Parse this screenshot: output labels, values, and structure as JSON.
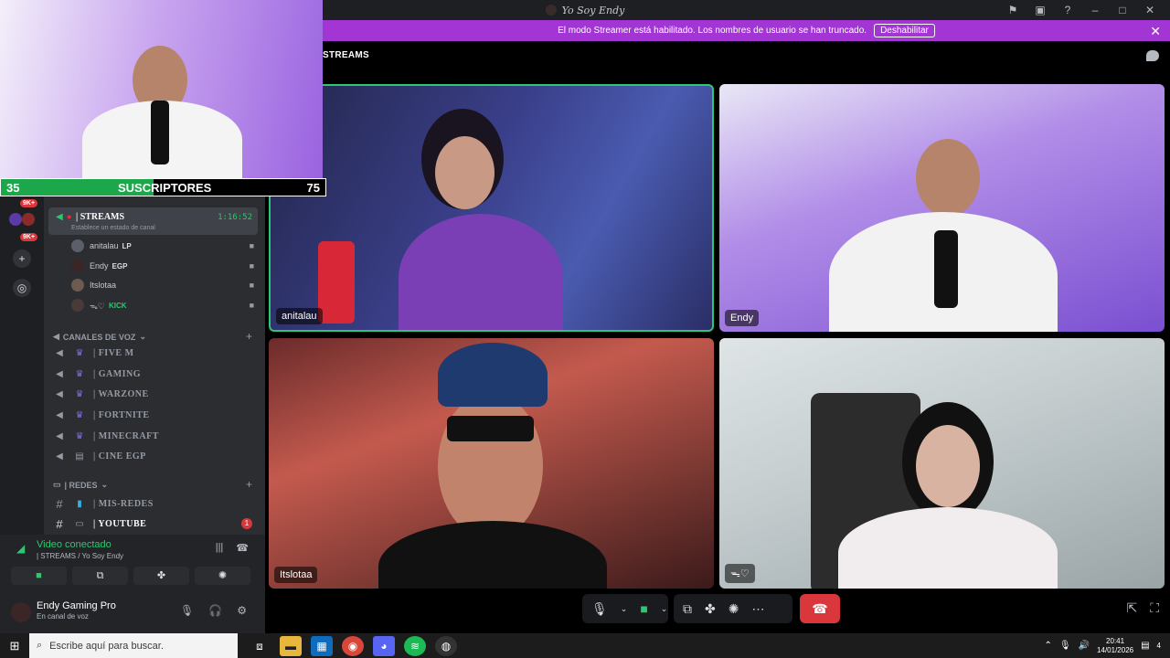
{
  "window": {
    "title": "Yo Soy Endy"
  },
  "banner": {
    "text": "El modo Streamer está habilitado. Los nombres de usuario se han truncado.",
    "button": "Deshabilitar"
  },
  "call": {
    "header": "STREAMS",
    "tiles": [
      {
        "name": "anitalau"
      },
      {
        "name": "Endy"
      },
      {
        "name": "Itslotaa"
      },
      {
        "name": "ᯓ♡"
      }
    ]
  },
  "overlay": {
    "left_count": "35",
    "label": "SUSCRIPTORES",
    "right_count": "75",
    "progress": 0.47
  },
  "rail": {
    "badges": [
      "9K+",
      "9K+"
    ]
  },
  "sidebar": {
    "active_channel": {
      "label": "| STREAMS",
      "status": "Establece un estado de canal",
      "timer": "1:16:52"
    },
    "members": [
      {
        "name": "anitalau",
        "tag": "LP"
      },
      {
        "name": "Endy",
        "tag": "EGP"
      },
      {
        "name": "Itslotaa",
        "tag": ""
      },
      {
        "name": "ᯓ♡",
        "tag": "KICK"
      }
    ],
    "voice_category": "CANALES DE VOZ",
    "voice_channels": [
      "| FIVE M",
      "| GAMING",
      "| WARZONE",
      "| FORTNITE",
      "| MINECRAFT",
      "| CINE EGP"
    ],
    "redes_category": "| REDES",
    "text_channels": [
      {
        "label": "| MIS-REDES",
        "badge": ""
      },
      {
        "label": "| YOUTUBE",
        "badge": "1"
      }
    ]
  },
  "voice_panel": {
    "title": "Video conectado",
    "subtitle": "| STREAMS / Yo Soy Endy"
  },
  "user_panel": {
    "name": "Endy Gaming Pro",
    "status": "En canal de voz"
  },
  "taskbar": {
    "search_placeholder": "Escribe aquí para buscar.",
    "time": "20:41",
    "date": "14/01/2026",
    "notif_count": "4"
  },
  "colors": {
    "accent": "#a235d4",
    "connected": "#2dc770",
    "hangup": "#da373c"
  }
}
